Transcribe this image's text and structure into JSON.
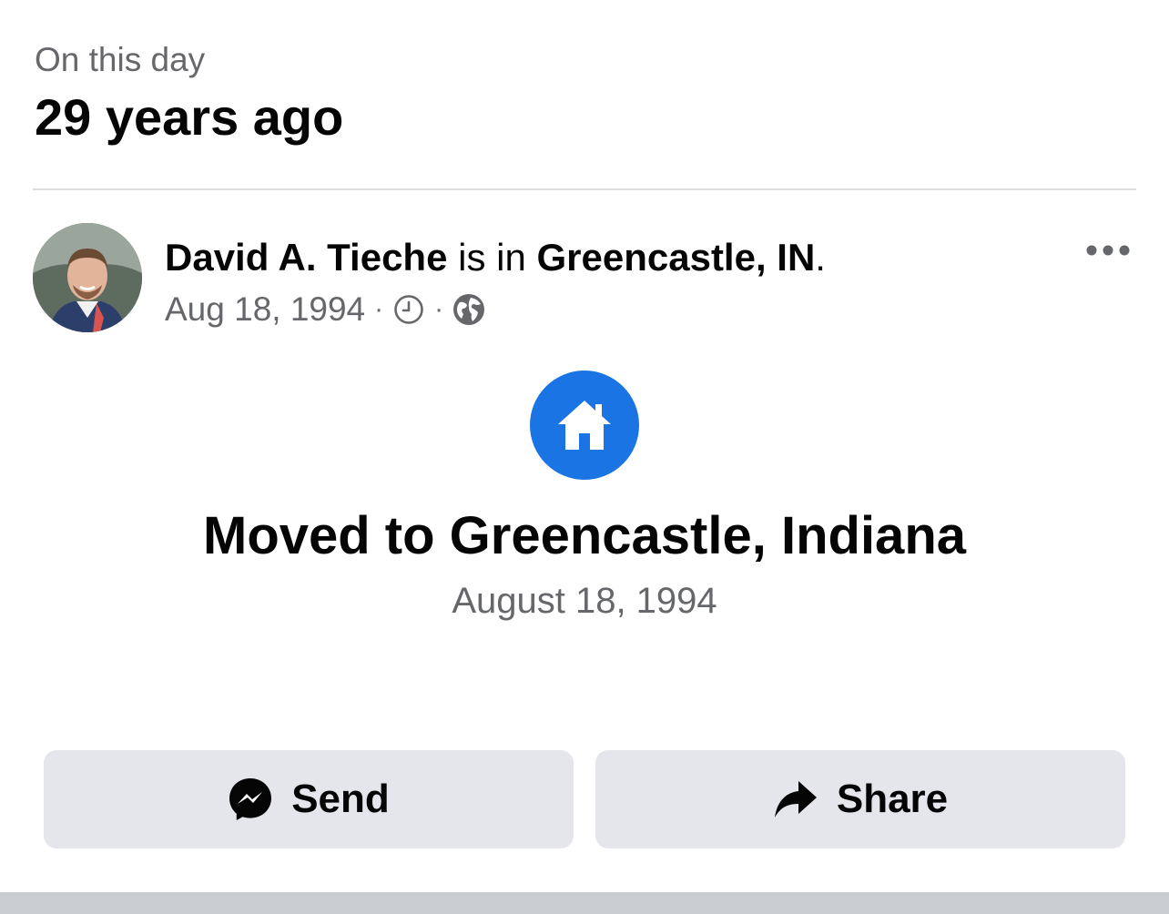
{
  "header": {
    "eyebrow": "On this day",
    "years_ago": "29 years ago"
  },
  "post": {
    "author": "David A. Tieche",
    "connector": " is in ",
    "location": "Greencastle, IN",
    "trailing": ".",
    "date": "Aug 18, 1994",
    "separator": "·",
    "privacy_icon": "globe-icon",
    "time_icon": "clock-icon",
    "more_icon": "more-options-icon"
  },
  "life_event": {
    "icon": "home-icon",
    "title": "Moved to Greencastle, Indiana",
    "date": "August 18, 1994"
  },
  "actions": {
    "send_label": "Send",
    "share_label": "Share"
  },
  "colors": {
    "accent": "#1b74e4",
    "secondary_text": "#65676b",
    "button_bg": "#e4e6eb"
  }
}
